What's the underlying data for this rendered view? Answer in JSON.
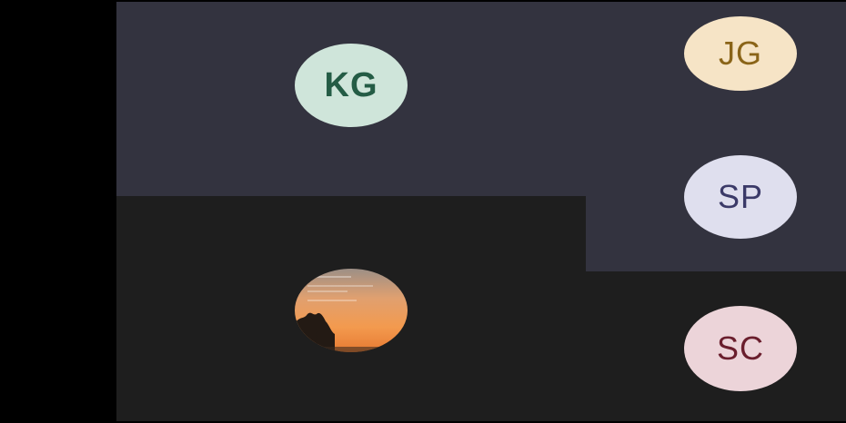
{
  "participants": {
    "main_top": {
      "initials": "KG",
      "name": "",
      "avatar_bg": "#cfe5da",
      "avatar_fg": "#245c45"
    },
    "main_bottom": {
      "initials": "",
      "name": "",
      "avatar_type": "photo-sunset"
    },
    "side_1": {
      "initials": "JG",
      "name": "",
      "avatar_bg": "#f6e4c6",
      "avatar_fg": "#8a6418"
    },
    "side_2": {
      "initials": "SP",
      "name": "",
      "avatar_bg": "#dfdfee",
      "avatar_fg": "#3b3a68"
    },
    "side_3": {
      "initials": "SC",
      "name": "",
      "avatar_bg": "#ecd4d9",
      "avatar_fg": "#6a1e2d"
    }
  },
  "colors": {
    "tile_dark_blue": "#33333f",
    "tile_dark_gray": "#1e1e1e",
    "background": "#000000"
  }
}
